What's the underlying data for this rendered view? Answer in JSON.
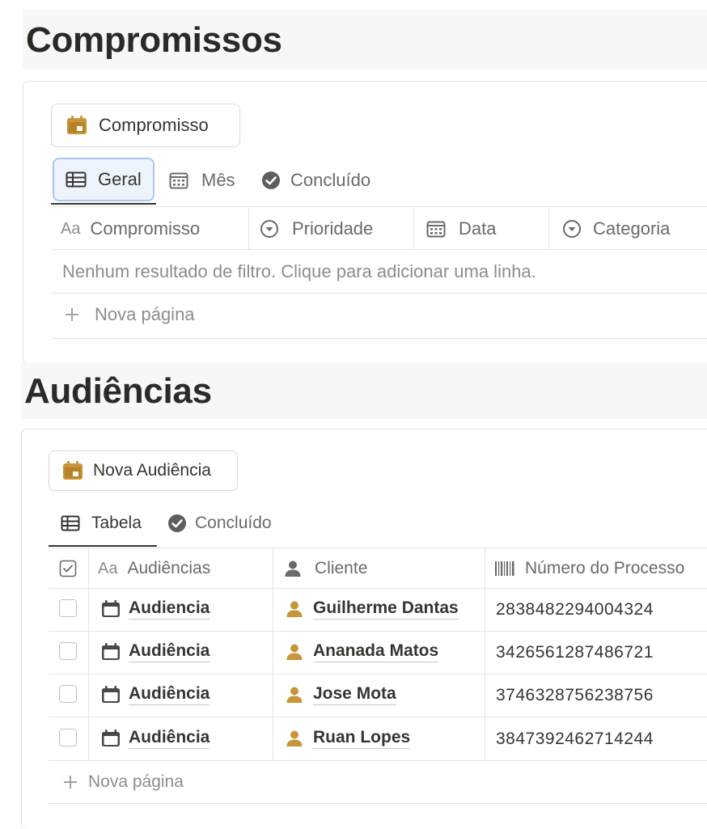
{
  "compromissos": {
    "title": "Compromissos",
    "new_button_label": "Compromisso",
    "tabs": [
      {
        "label": "Geral",
        "active": true
      },
      {
        "label": "Mês",
        "active": false
      },
      {
        "label": "Concluído",
        "active": false
      }
    ],
    "columns": [
      "Compromisso",
      "Prioridade",
      "Data",
      "Categoria"
    ],
    "title_column_prefix": "Aa",
    "empty_message": "Nenhum resultado de filtro. Clique para adicionar uma linha.",
    "new_page_label": "Nova página"
  },
  "audiencias": {
    "title": "Audiências",
    "new_button_label": "Nova Audiência",
    "tabs": [
      {
        "label": "Tabela",
        "active": true
      },
      {
        "label": "Concluído",
        "active": false
      }
    ],
    "columns": [
      "Audiências",
      "Cliente",
      "Número do Processo"
    ],
    "title_column_prefix": "Aa",
    "rows": [
      {
        "title": "Audiencia",
        "cliente": "Guilherme Dantas",
        "numero": "2838482294004324"
      },
      {
        "title": "Audiência",
        "cliente": "Ananada Matos",
        "numero": "3426561287486721"
      },
      {
        "title": "Audiência",
        "cliente": "Jose Mota",
        "numero": "3746328756238756"
      },
      {
        "title": "Audiência",
        "cliente": "Ruan Lopes",
        "numero": "3847392462714244"
      }
    ],
    "new_page_label": "Nova página"
  },
  "colors": {
    "calendar_accent": "#c8953a",
    "person_accent": "#c8953a",
    "active_tab_focus": "#4a90e2"
  }
}
